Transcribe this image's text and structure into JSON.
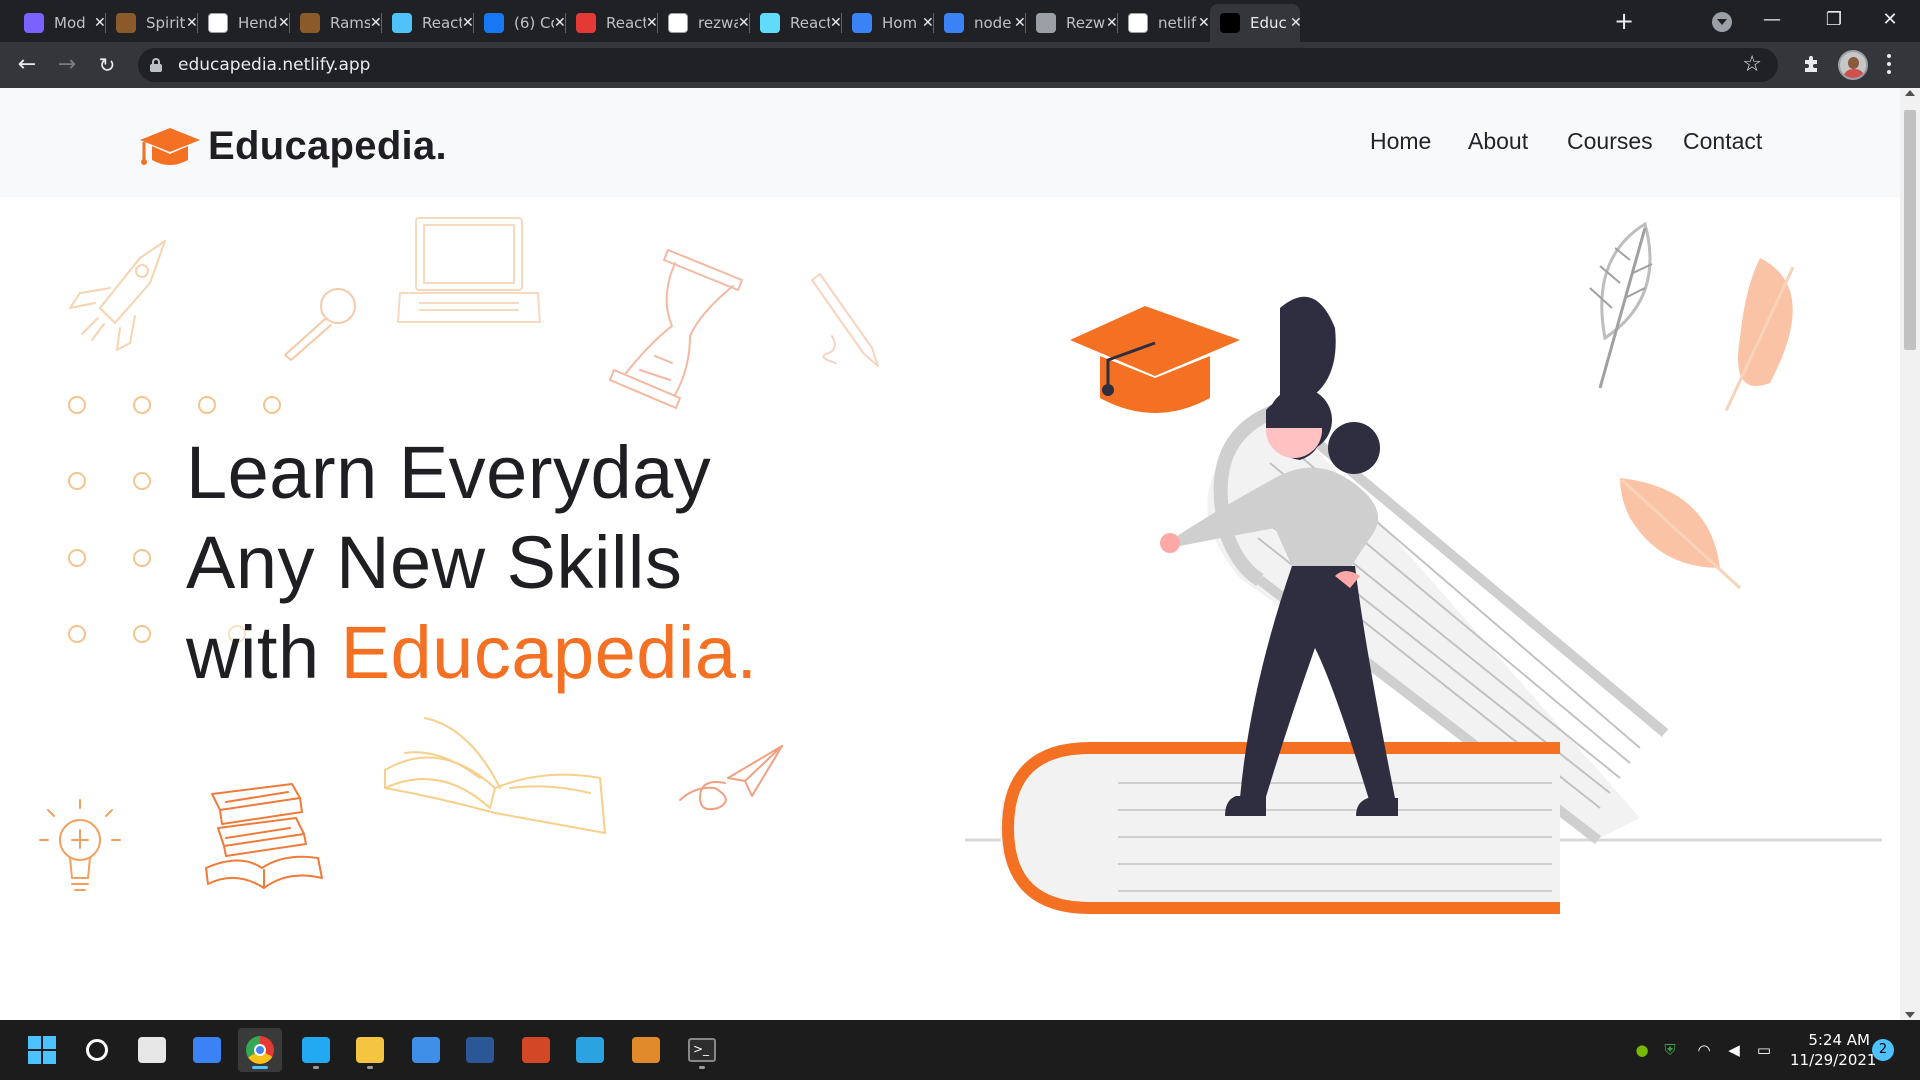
{
  "browser": {
    "tabs": [
      {
        "title": "Mod",
        "favicon_color": "#7b61ff"
      },
      {
        "title": "Spirit",
        "favicon_color": "#8a5a2b"
      },
      {
        "title": "Hend",
        "favicon_color": "#ffffff"
      },
      {
        "title": "Rams",
        "favicon_color": "#8a5a2b"
      },
      {
        "title": "React",
        "favicon_color": "#4fc3f7"
      },
      {
        "title": "(6) Co",
        "favicon_color": "#1877f2"
      },
      {
        "title": "React",
        "favicon_color": "#e53935"
      },
      {
        "title": "rezwa",
        "favicon_color": "#ffffff"
      },
      {
        "title": "React",
        "favicon_color": "#61dafb"
      },
      {
        "title": "Hom",
        "favicon_color": "#3b82f6"
      },
      {
        "title": "node",
        "favicon_color": "#3b82f6"
      },
      {
        "title": "Rezw",
        "favicon_color": "#9aa0a6"
      },
      {
        "title": "netlif",
        "favicon_color": "#ffffff"
      },
      {
        "title": "Educ",
        "favicon_color": "#000000",
        "active": true
      }
    ],
    "url": "educapedia.netlify.app"
  },
  "site": {
    "brand": "Educapedia.",
    "nav": [
      "Home",
      "About",
      "Courses",
      "Contact"
    ],
    "hero": {
      "line1": "Learn Everyday",
      "line2": "Any New Skills",
      "line3_prefix": "with ",
      "line3_accent": "Educapedia."
    }
  },
  "colors": {
    "accent": "#f47023",
    "dark": "#1f1f23",
    "header_bg": "#f8f9fa",
    "dots": "#f5c48c"
  },
  "taskbar": {
    "apps": [
      "windows-start",
      "search",
      "task-view",
      "widgets",
      "chrome",
      "vscode",
      "file-explorer",
      "mail",
      "word",
      "powerpoint",
      "telegram",
      "sublime-text",
      "terminal"
    ],
    "time": "5:24 AM",
    "date": "11/29/2021",
    "notifications": "2"
  }
}
